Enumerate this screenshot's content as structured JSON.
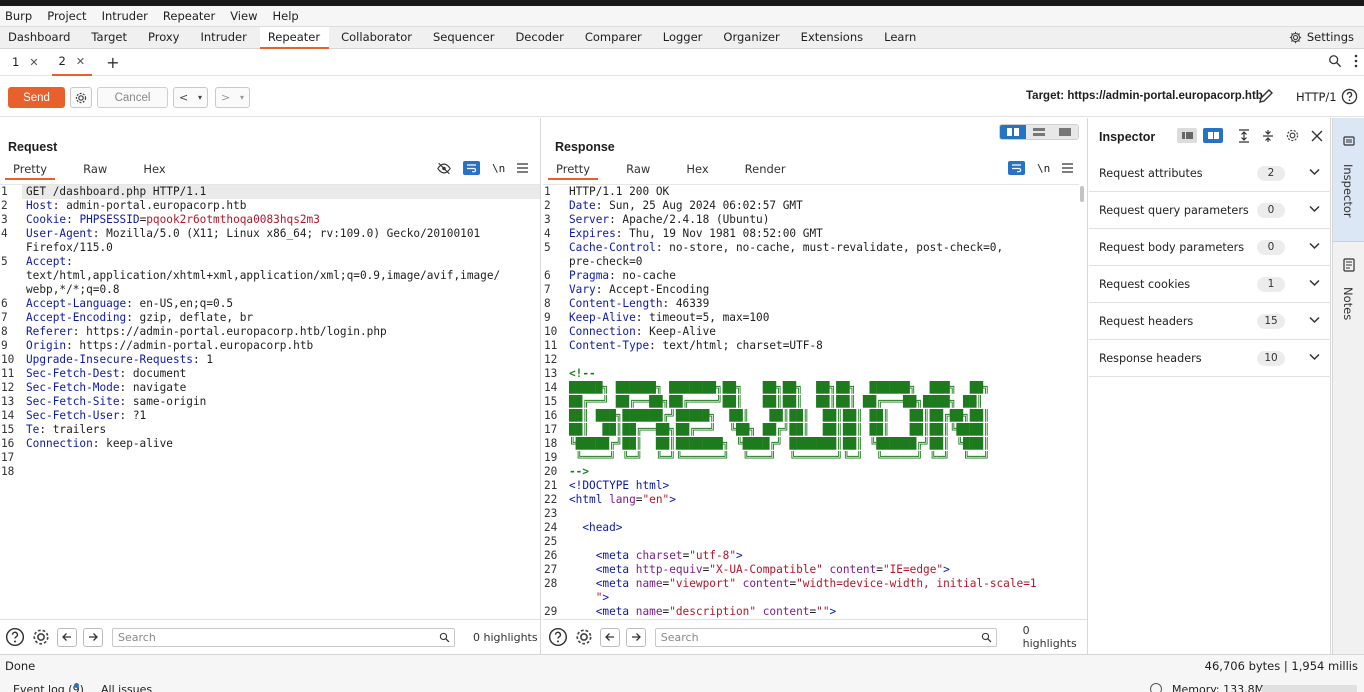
{
  "menu": [
    "Burp",
    "Project",
    "Intruder",
    "Repeater",
    "View",
    "Help"
  ],
  "nav_tabs": [
    "Dashboard",
    "Target",
    "Proxy",
    "Intruder",
    "Repeater",
    "Collaborator",
    "Sequencer",
    "Decoder",
    "Comparer",
    "Logger",
    "Organizer",
    "Extensions",
    "Learn"
  ],
  "nav_active": "Repeater",
  "settings_label": "Settings",
  "sub_tabs": [
    {
      "label": "1"
    },
    {
      "label": "2"
    }
  ],
  "toolbar": {
    "send": "Send",
    "cancel": "Cancel",
    "target": "Target: https://admin-portal.europacorp.htb",
    "http_version": "HTTP/1"
  },
  "request": {
    "title": "Request",
    "tabs": [
      "Pretty",
      "Raw",
      "Hex"
    ],
    "lines": [
      {
        "n": "1",
        "parts": [
          [
            "",
            "GET /dashboard.php HTTP/1.1"
          ]
        ]
      },
      {
        "n": "2",
        "parts": [
          [
            "hk",
            "Host"
          ],
          [
            "",
            ": admin-portal.europacorp.htb"
          ]
        ]
      },
      {
        "n": "3",
        "parts": [
          [
            "hk",
            "Cookie"
          ],
          [
            "",
            ": "
          ],
          [
            "hk",
            "PHPSESSID"
          ],
          [
            "",
            "="
          ],
          [
            "hc",
            "pqook2r6otmthoqa0083hqs2m3"
          ]
        ]
      },
      {
        "n": "4",
        "parts": [
          [
            "hk",
            "User-Agent"
          ],
          [
            "",
            ": Mozilla/5.0 (X11; Linux x86_64; rv:109.0) Gecko/20100101"
          ]
        ]
      },
      {
        "n": "",
        "parts": [
          [
            "",
            "Firefox/115.0"
          ]
        ]
      },
      {
        "n": "5",
        "parts": [
          [
            "hk",
            "Accept"
          ],
          [
            "",
            ":"
          ]
        ]
      },
      {
        "n": "",
        "parts": [
          [
            "",
            "text/html,application/xhtml+xml,application/xml;q=0.9,image/avif,image/"
          ]
        ]
      },
      {
        "n": "",
        "parts": [
          [
            "",
            "webp,*/*;q=0.8"
          ]
        ]
      },
      {
        "n": "6",
        "parts": [
          [
            "hk",
            "Accept-Language"
          ],
          [
            "",
            ": en-US,en;q=0.5"
          ]
        ]
      },
      {
        "n": "7",
        "parts": [
          [
            "hk",
            "Accept-Encoding"
          ],
          [
            "",
            ": gzip, deflate, br"
          ]
        ]
      },
      {
        "n": "8",
        "parts": [
          [
            "hk",
            "Referer"
          ],
          [
            "",
            ": https://admin-portal.europacorp.htb/login.php"
          ]
        ]
      },
      {
        "n": "9",
        "parts": [
          [
            "hk",
            "Origin"
          ],
          [
            "",
            ": https://admin-portal.europacorp.htb"
          ]
        ]
      },
      {
        "n": "10",
        "parts": [
          [
            "hk",
            "Upgrade-Insecure-Requests"
          ],
          [
            "",
            ": 1"
          ]
        ]
      },
      {
        "n": "11",
        "parts": [
          [
            "hk",
            "Sec-Fetch-Dest"
          ],
          [
            "",
            ": document"
          ]
        ]
      },
      {
        "n": "12",
        "parts": [
          [
            "hk",
            "Sec-Fetch-Mode"
          ],
          [
            "",
            ": navigate"
          ]
        ]
      },
      {
        "n": "13",
        "parts": [
          [
            "hk",
            "Sec-Fetch-Site"
          ],
          [
            "",
            ": same-origin"
          ]
        ]
      },
      {
        "n": "14",
        "parts": [
          [
            "hk",
            "Sec-Fetch-User"
          ],
          [
            "",
            ": ?1"
          ]
        ]
      },
      {
        "n": "15",
        "parts": [
          [
            "hk",
            "Te"
          ],
          [
            "",
            ": trailers"
          ]
        ]
      },
      {
        "n": "16",
        "parts": [
          [
            "hk",
            "Connection"
          ],
          [
            "",
            ": keep-alive"
          ]
        ]
      },
      {
        "n": "17",
        "parts": [
          [
            "",
            ""
          ]
        ]
      },
      {
        "n": "18",
        "parts": [
          [
            "",
            ""
          ]
        ]
      }
    ],
    "search_placeholder": "Search",
    "highlights": "0 highlights"
  },
  "response": {
    "title": "Response",
    "tabs": [
      "Pretty",
      "Raw",
      "Hex",
      "Render"
    ],
    "lines": [
      {
        "n": "1",
        "parts": [
          [
            "",
            "HTTP/1.1 200 OK"
          ]
        ]
      },
      {
        "n": "2",
        "parts": [
          [
            "hk",
            "Date"
          ],
          [
            "",
            ": Sun, 25 Aug 2024 06:02:57 GMT"
          ]
        ]
      },
      {
        "n": "3",
        "parts": [
          [
            "hk",
            "Server"
          ],
          [
            "",
            ": Apache/2.4.18 (Ubuntu)"
          ]
        ]
      },
      {
        "n": "4",
        "parts": [
          [
            "hk",
            "Expires"
          ],
          [
            "",
            ": Thu, 19 Nov 1981 08:52:00 GMT"
          ]
        ]
      },
      {
        "n": "5",
        "parts": [
          [
            "hk",
            "Cache-Control"
          ],
          [
            "",
            ": no-store, no-cache, must-revalidate, post-check=0,"
          ]
        ]
      },
      {
        "n": "",
        "parts": [
          [
            "",
            "pre-check=0"
          ]
        ]
      },
      {
        "n": "6",
        "parts": [
          [
            "hk",
            "Pragma"
          ],
          [
            "",
            ": no-cache"
          ]
        ]
      },
      {
        "n": "7",
        "parts": [
          [
            "hk",
            "Vary"
          ],
          [
            "",
            ": Accept-Encoding"
          ]
        ]
      },
      {
        "n": "8",
        "parts": [
          [
            "hk",
            "Content-Length"
          ],
          [
            "",
            ": 46339"
          ]
        ]
      },
      {
        "n": "9",
        "parts": [
          [
            "hk",
            "Keep-Alive"
          ],
          [
            "",
            ": timeout=5, max=100"
          ]
        ]
      },
      {
        "n": "10",
        "parts": [
          [
            "hk",
            "Connection"
          ],
          [
            "",
            ": Keep-Alive"
          ]
        ]
      },
      {
        "n": "11",
        "parts": [
          [
            "hk",
            "Content-Type"
          ],
          [
            "",
            ": text/html; charset=UTF-8"
          ]
        ]
      },
      {
        "n": "12",
        "parts": [
          [
            "",
            ""
          ]
        ]
      },
      {
        "n": "13",
        "parts": [
          [
            "ascii",
            "<!--"
          ]
        ]
      },
      {
        "n": "14",
        "parts": [
          [
            "ascii",
            "█████╗ ██████╗ ███████╗██╗   ██╗██╗  ██╗██╗  ██████╗  ███╗  ██╗"
          ]
        ]
      },
      {
        "n": "15",
        "parts": [
          [
            "ascii",
            "██╔══╝ ██╔══██╗██╔════╝██║   ██║██║  ██║██║ ██╔═══██╗████╗ ██║"
          ]
        ]
      },
      {
        "n": "16",
        "parts": [
          [
            "ascii",
            "██║ ███╗██████╔╝█████╗  ██║   ██║██║  ██║██║ ██║   ██║██╔██╗██║"
          ]
        ]
      },
      {
        "n": "17",
        "parts": [
          [
            "ascii",
            "██║  ██║██╔══██╗██╔══╝  ╚██╗ ██╔╝██║  ██║██║ ██║   ██║██║╚████║"
          ]
        ]
      },
      {
        "n": "18",
        "parts": [
          [
            "ascii",
            "╚█████╔╝██║  ██║███████╗ ╚████╔╝ ███████║██║ ╚██████╔╝██║ ╚███║"
          ]
        ]
      },
      {
        "n": "19",
        "parts": [
          [
            "ascii",
            " ╚════╝ ╚═╝  ╚═╝╚══════╝  ╚═══╝  ╚══════╝╚═╝  ╚═════╝ ╚═╝  ╚══╝"
          ]
        ]
      },
      {
        "n": "20",
        "parts": [
          [
            "ascii",
            "-->"
          ]
        ]
      },
      {
        "n": "21",
        "parts": [
          [
            "tag",
            "<!DOCTYPE html>"
          ]
        ]
      },
      {
        "n": "22",
        "parts": [
          [
            "tag",
            "<html "
          ],
          [
            "attr",
            "lang"
          ],
          [
            "",
            "="
          ],
          [
            "aval",
            "\"en\""
          ],
          [
            "tag",
            ">"
          ]
        ]
      },
      {
        "n": "23",
        "parts": [
          [
            "",
            ""
          ]
        ]
      },
      {
        "n": "24",
        "parts": [
          [
            "",
            "  "
          ],
          [
            "tag",
            "<head>"
          ]
        ]
      },
      {
        "n": "25",
        "parts": [
          [
            "",
            ""
          ]
        ]
      },
      {
        "n": "26",
        "parts": [
          [
            "",
            "    "
          ],
          [
            "tag",
            "<meta "
          ],
          [
            "attr",
            "charset"
          ],
          [
            "",
            "="
          ],
          [
            "aval",
            "\"utf-8\""
          ],
          [
            "tag",
            ">"
          ]
        ]
      },
      {
        "n": "27",
        "parts": [
          [
            "",
            "    "
          ],
          [
            "tag",
            "<meta "
          ],
          [
            "attr",
            "http-equiv"
          ],
          [
            "",
            "="
          ],
          [
            "aval",
            "\"X-UA-Compatible\""
          ],
          [
            "attr",
            " content"
          ],
          [
            "",
            "="
          ],
          [
            "aval",
            "\"IE=edge\""
          ],
          [
            "tag",
            ">"
          ]
        ]
      },
      {
        "n": "28",
        "parts": [
          [
            "",
            "    "
          ],
          [
            "tag",
            "<meta "
          ],
          [
            "attr",
            "name"
          ],
          [
            "",
            "="
          ],
          [
            "aval",
            "\"viewport\""
          ],
          [
            "attr",
            " content"
          ],
          [
            "",
            "="
          ],
          [
            "aval",
            "\"width=device-width, initial-scale=1"
          ]
        ]
      },
      {
        "n": "",
        "parts": [
          [
            "",
            "    "
          ],
          [
            "aval",
            "\""
          ],
          [
            "tag",
            ">"
          ]
        ]
      },
      {
        "n": "29",
        "parts": [
          [
            "",
            "    "
          ],
          [
            "tag",
            "<meta "
          ],
          [
            "attr",
            "name"
          ],
          [
            "",
            "="
          ],
          [
            "aval",
            "\"description\""
          ],
          [
            "attr",
            " content"
          ],
          [
            "",
            "="
          ],
          [
            "aval",
            "\"\""
          ],
          [
            "tag",
            ">"
          ]
        ]
      }
    ],
    "search_placeholder": "Search",
    "highlights": "0 highlights"
  },
  "inspector": {
    "title": "Inspector",
    "rows": [
      {
        "label": "Request attributes",
        "count": "2"
      },
      {
        "label": "Request query parameters",
        "count": "0"
      },
      {
        "label": "Request body parameters",
        "count": "0"
      },
      {
        "label": "Request cookies",
        "count": "1"
      },
      {
        "label": "Request headers",
        "count": "15"
      },
      {
        "label": "Response headers",
        "count": "10"
      }
    ]
  },
  "sidebar": {
    "inspector_label": "Inspector",
    "notes_label": "Notes"
  },
  "status": {
    "left": "Done",
    "right": "46,706 bytes | 1,954 millis"
  },
  "bottom": {
    "event_log": "Event log (9)",
    "all_issues": "All issues",
    "memory": "Memory: 133.8MB"
  },
  "colors": {
    "accent": "#e8612c",
    "selected_blue": "#2673c4"
  }
}
